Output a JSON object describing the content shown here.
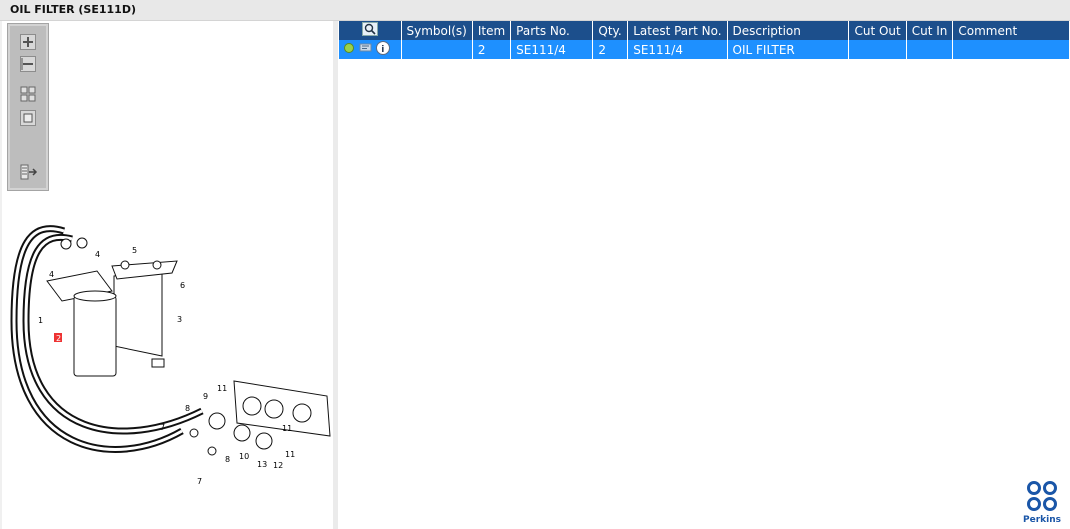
{
  "window": {
    "title": "OIL FILTER (SE111D)"
  },
  "toolbar": {
    "buttons": [
      {
        "icon": "zoom-in-icon"
      },
      {
        "icon": "zoom-out-icon"
      },
      {
        "icon": "fit-page-icon"
      },
      {
        "icon": "actual-size-icon"
      },
      {
        "icon": "export-icon"
      }
    ]
  },
  "diagram": {
    "callouts": [
      "1",
      "2",
      "3",
      "4",
      "4",
      "5",
      "6",
      "7",
      "7",
      "8",
      "8",
      "9",
      "10",
      "11",
      "11",
      "11",
      "12",
      "13"
    ],
    "highlighted_callout": "2"
  },
  "table": {
    "columns": [
      "",
      "Symbol(s)",
      "Item",
      "Parts No.",
      "Qty.",
      "Latest Part No.",
      "Description",
      "Cut Out",
      "Cut In",
      "Comment"
    ],
    "rows": [
      {
        "symbols": "",
        "item": "2",
        "parts_no": "SE111/4",
        "qty": "2",
        "latest_part_no": "SE111/4",
        "description": "OIL FILTER",
        "cut_out": "",
        "cut_in": "",
        "comment": ""
      }
    ],
    "selected_row_color": "#1e90ff",
    "header_color": "#1c4f8c"
  },
  "brand": {
    "name": "Perkins",
    "color": "#1a56a8"
  }
}
